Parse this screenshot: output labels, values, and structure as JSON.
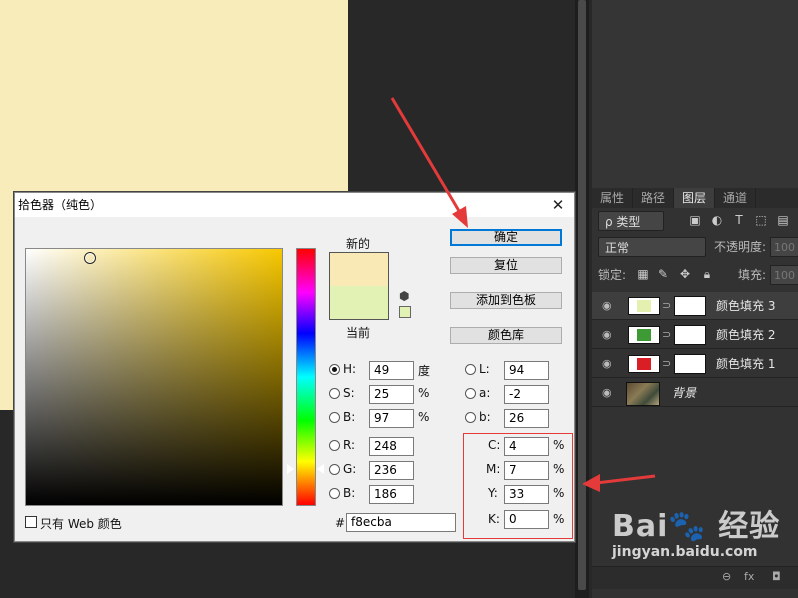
{
  "colors": {
    "canvas_fill": "#f8ecba",
    "new_color": "#f8e9b5",
    "current_color": "#e2f1b4",
    "layer3_swatch": "#e4f0b0",
    "layer2_swatch": "#3d9a35",
    "layer1_swatch": "#d91f25",
    "annotation_red": "#e43a3a"
  },
  "dialog": {
    "title": "拾色器（纯色）",
    "new_label": "新的",
    "current_label": "当前",
    "buttons": {
      "ok": "确定",
      "reset": "复位",
      "add_to_swatches": "添加到色板",
      "color_libraries": "颜色库"
    },
    "hsb": {
      "h_label": "H:",
      "h_value": "49",
      "h_unit": "度",
      "s_label": "S:",
      "s_value": "25",
      "s_unit": "%",
      "b_label": "B:",
      "b_value": "97",
      "b_unit": "%"
    },
    "rgb": {
      "r_label": "R:",
      "r_value": "248",
      "g_label": "G:",
      "g_value": "236",
      "b_label": "B:",
      "b_value": "186"
    },
    "lab": {
      "l_label": "L:",
      "l_value": "94",
      "a_label": "a:",
      "a_value": "-2",
      "b_label": "b:",
      "b_value": "26"
    },
    "cmyk": {
      "c_label": "C:",
      "c_value": "4",
      "m_label": "M:",
      "m_value": "7",
      "y_label": "Y:",
      "y_value": "33",
      "k_label": "K:",
      "k_value": "0",
      "unit": "%"
    },
    "hex_label": "#",
    "hex_value": "f8ecba",
    "web_only_label": "只有 Web 颜色",
    "close_glyph": "✕"
  },
  "layers_panel": {
    "tabs": [
      "属性",
      "路径",
      "图层",
      "通道"
    ],
    "active_tab": "图层",
    "filter_label": "ρ 类型",
    "blend_mode": "正常",
    "opacity_label": "不透明度:",
    "opacity_value": "100",
    "lock_label": "锁定:",
    "fill_label": "填充:",
    "fill_value": "100",
    "layers": [
      {
        "name": "颜色填充 3",
        "selected": true
      },
      {
        "name": "颜色填充 2",
        "selected": false
      },
      {
        "name": "颜色填充 1",
        "selected": false
      },
      {
        "name": "背景",
        "selected": false
      }
    ],
    "bottom_fx": "fx"
  },
  "watermark": {
    "logo": "Bai🐾 经验",
    "url": "jingyan.baidu.com"
  }
}
